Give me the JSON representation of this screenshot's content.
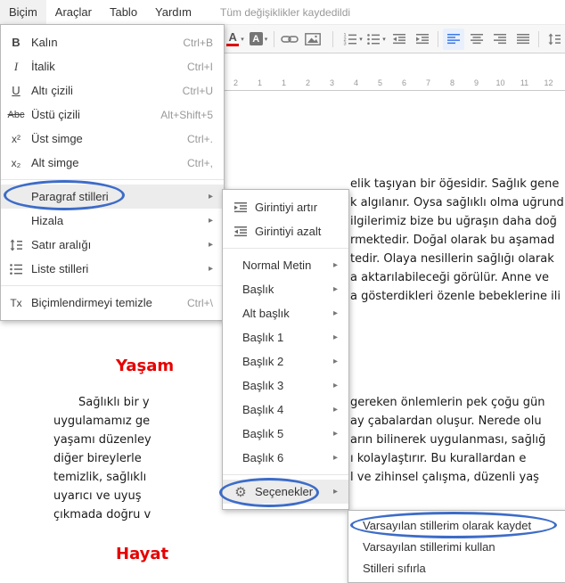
{
  "menubar": {
    "items": [
      {
        "label": "Biçim"
      },
      {
        "label": "Araçlar"
      },
      {
        "label": "Tablo"
      },
      {
        "label": "Yardım"
      }
    ],
    "status": "Tüm değişiklikler kaydedildi"
  },
  "toolbar": {
    "text_color_glyph": "A",
    "highlight_glyph": "A"
  },
  "ui": {
    "submenu_arrow": "▸",
    "dropdown_caret": "▾",
    "gear_glyph": "⚙"
  },
  "ruler": {
    "numbers": [
      "2",
      "1",
      "1",
      "2",
      "3",
      "4",
      "5",
      "6",
      "7",
      "8",
      "9",
      "10",
      "11",
      "12"
    ]
  },
  "format_menu": {
    "items": [
      {
        "icon": "bold-icon",
        "icon_glyph": "B",
        "label": "Kalın",
        "shortcut": "Ctrl+B"
      },
      {
        "icon": "italic-icon",
        "icon_glyph": "I",
        "label": "İtalik",
        "shortcut": "Ctrl+I"
      },
      {
        "icon": "underline-icon",
        "icon_glyph": "U",
        "label": "Altı çizili",
        "shortcut": "Ctrl+U"
      },
      {
        "icon": "strikethrough-icon",
        "icon_glyph": "Abc",
        "label": "Üstü çizili",
        "shortcut": "Alt+Shift+5"
      },
      {
        "icon": "superscript-icon",
        "icon_glyph": "x²",
        "label": "Üst simge",
        "shortcut": "Ctrl+."
      },
      {
        "icon": "subscript-icon",
        "icon_glyph": "x₂",
        "label": "Alt simge",
        "shortcut": "Ctrl+,"
      },
      {
        "icon": "",
        "label": "Paragraf stilleri",
        "has_submenu": true
      },
      {
        "icon": "",
        "label": "Hizala",
        "has_submenu": true
      },
      {
        "icon": "line-spacing-icon",
        "label": "Satır aralığı",
        "has_submenu": true
      },
      {
        "icon": "list-styles-icon",
        "label": "Liste stilleri",
        "has_submenu": true
      },
      {
        "icon": "clear-formatting-icon",
        "icon_glyph": "Tx",
        "label": "Biçimlendirmeyi temizle",
        "shortcut": "Ctrl+\\"
      }
    ]
  },
  "styles_menu": {
    "items": [
      {
        "icon": "indent-increase-icon",
        "label": "Girintiyi artır"
      },
      {
        "icon": "indent-decrease-icon",
        "label": "Girintiyi azalt"
      },
      {
        "label": "Normal Metin",
        "has_submenu": true
      },
      {
        "label": "Başlık",
        "has_submenu": true
      },
      {
        "label": "Alt başlık",
        "has_submenu": true
      },
      {
        "label": "Başlık 1",
        "has_submenu": true
      },
      {
        "label": "Başlık 2",
        "has_submenu": true
      },
      {
        "label": "Başlık 3",
        "has_submenu": true
      },
      {
        "label": "Başlık 4",
        "has_submenu": true
      },
      {
        "label": "Başlık 5",
        "has_submenu": true
      },
      {
        "label": "Başlık 6",
        "has_submenu": true
      },
      {
        "icon": "gear-icon",
        "label": "Seçenekler",
        "has_submenu": true
      }
    ]
  },
  "options_menu": {
    "items": [
      {
        "label": "Varsayılan stillerim olarak kaydet"
      },
      {
        "label": "Varsayılan stillerimi kullan"
      },
      {
        "label": "Stilleri sıfırla"
      }
    ]
  },
  "document": {
    "right_lines": [
      "elik taşıyan bir öğesidir. Sağlık gene",
      "k algılanır. Oysa sağlıklı olma uğrund",
      "ilgilerimiz bize bu uğraşın daha doğ",
      "rmektedir. Doğal olarak bu aşamad",
      "tedir. Olaya nesillerin sağlığı olarak",
      "a aktarılabileceği görülür. Anne ve",
      "a gösterdikleri özenle bebeklerine ili"
    ],
    "heading1": "Yaşam",
    "para_left": [
      "Sağlıklı bir y",
      "uygulamamız ge",
      "yaşamı düzenley",
      "diğer bireylerle",
      "temizlik, sağlıklı",
      "uyarıcı ve uyuş",
      "çıkmada doğru v"
    ],
    "para_right": [
      "gereken önlemlerin pek çoğu gün",
      "ay çabalardan oluşur. Nerede olu",
      "arın bilinerek uygulanması, sağlığ",
      "ı kolaylaştırır. Bu kurallardan e",
      "l ve zihinsel çalışma, düzenli yaş"
    ],
    "heading2": "Hayat"
  },
  "colors": {
    "heading_red": "#e60000",
    "annotation_blue": "#3d6cc8",
    "selected_blue": "#3b78e7",
    "text_color_underline_red": "#e00000"
  }
}
